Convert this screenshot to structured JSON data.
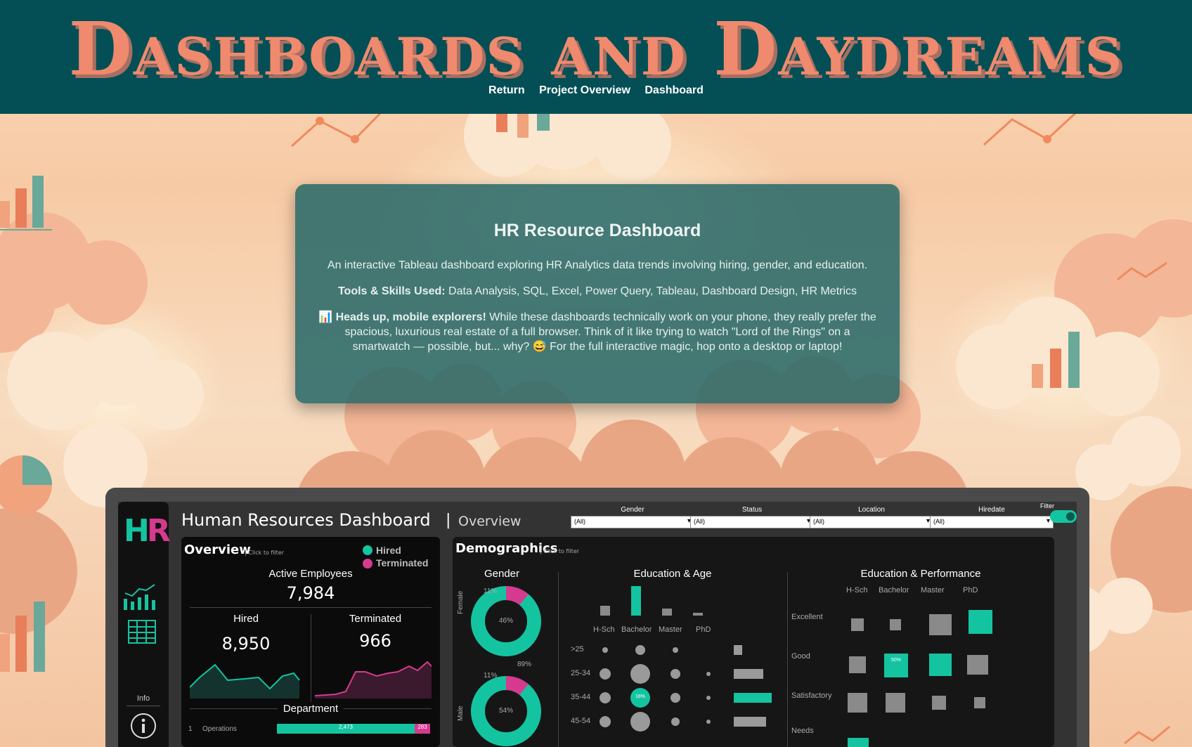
{
  "site": {
    "title": "Dashboards and Daydreams",
    "nav": [
      "Return",
      "Project Overview",
      "Dashboard"
    ]
  },
  "card": {
    "title": "HR Resource Dashboard",
    "description": "An interactive Tableau dashboard exploring HR Analytics data trends involving hiring, gender, and education.",
    "tools_label": "Tools & Skills Used:",
    "tools": " Data Analysis, SQL, Excel, Power Query, Tableau, Dashboard Design, HR Metrics",
    "notice_icon": "📊",
    "notice_bold": "Heads up, mobile explorers!",
    "notice_a": " While these dashboards technically work on your phone, they really prefer the spacious, luxurious real estate of a full browser. Think of it like trying to watch \"Lord of the Rings\" on a smartwatch — possible, but... why? ",
    "notice_emoji": "😅",
    "notice_b": " For the full interactive magic, hop onto a desktop or laptop!"
  },
  "dashboard": {
    "title": "Human Resources Dashboard",
    "separator": "|",
    "subtitle": "Overview",
    "filters": [
      {
        "label": "Gender",
        "value": "(All)"
      },
      {
        "label": "Status",
        "value": "(All)"
      },
      {
        "label": "Location",
        "value": "(All)"
      },
      {
        "label": "Hiredate",
        "value": "(All)"
      }
    ],
    "filter_toggle_label": "Filter",
    "sidebar": {
      "info_label": "Info",
      "logo_h": "H",
      "logo_r": "R"
    },
    "colors": {
      "hired": "#14c4a0",
      "terminated": "#d63a8f"
    },
    "overview": {
      "title": "Overview",
      "click_hint": "| Click to filter",
      "legend": [
        "Hired",
        "Terminated"
      ],
      "active_label": "Active Employees",
      "active_value": "7,984",
      "hired_label": "Hired",
      "hired_value": "8,950",
      "terminated_label": "Terminated",
      "terminated_value": "966",
      "department_label": "Department",
      "dept_row": {
        "rank": "1",
        "name": "Operations",
        "hired": "2,473",
        "terminated": "283"
      }
    },
    "demographics": {
      "title": "Demographics",
      "click_hint": "| Click to filter",
      "gender_title": "Gender",
      "female": {
        "label": "Female",
        "pct_outer": "11%",
        "pct_inner": "46%",
        "pct_hired": "89%",
        "terminated_fraction": 0.11
      },
      "male": {
        "label": "Male",
        "pct_outer": "11%",
        "pct_inner": "54%",
        "terminated_fraction": 0.11
      },
      "edu_age_title": "Education & Age",
      "education_levels": [
        "H-Sch",
        "Bachelor",
        "Master",
        "PhD"
      ],
      "age_groups": [
        ">25",
        "25-34",
        "35-44",
        "45-54"
      ],
      "highlight_label": "18%",
      "edu_perf_title": "Education & Performance",
      "performance_levels": [
        "Excellent",
        "Good",
        "Satisfactory",
        "Needs"
      ],
      "perf_highlight_label": "50%"
    }
  }
}
